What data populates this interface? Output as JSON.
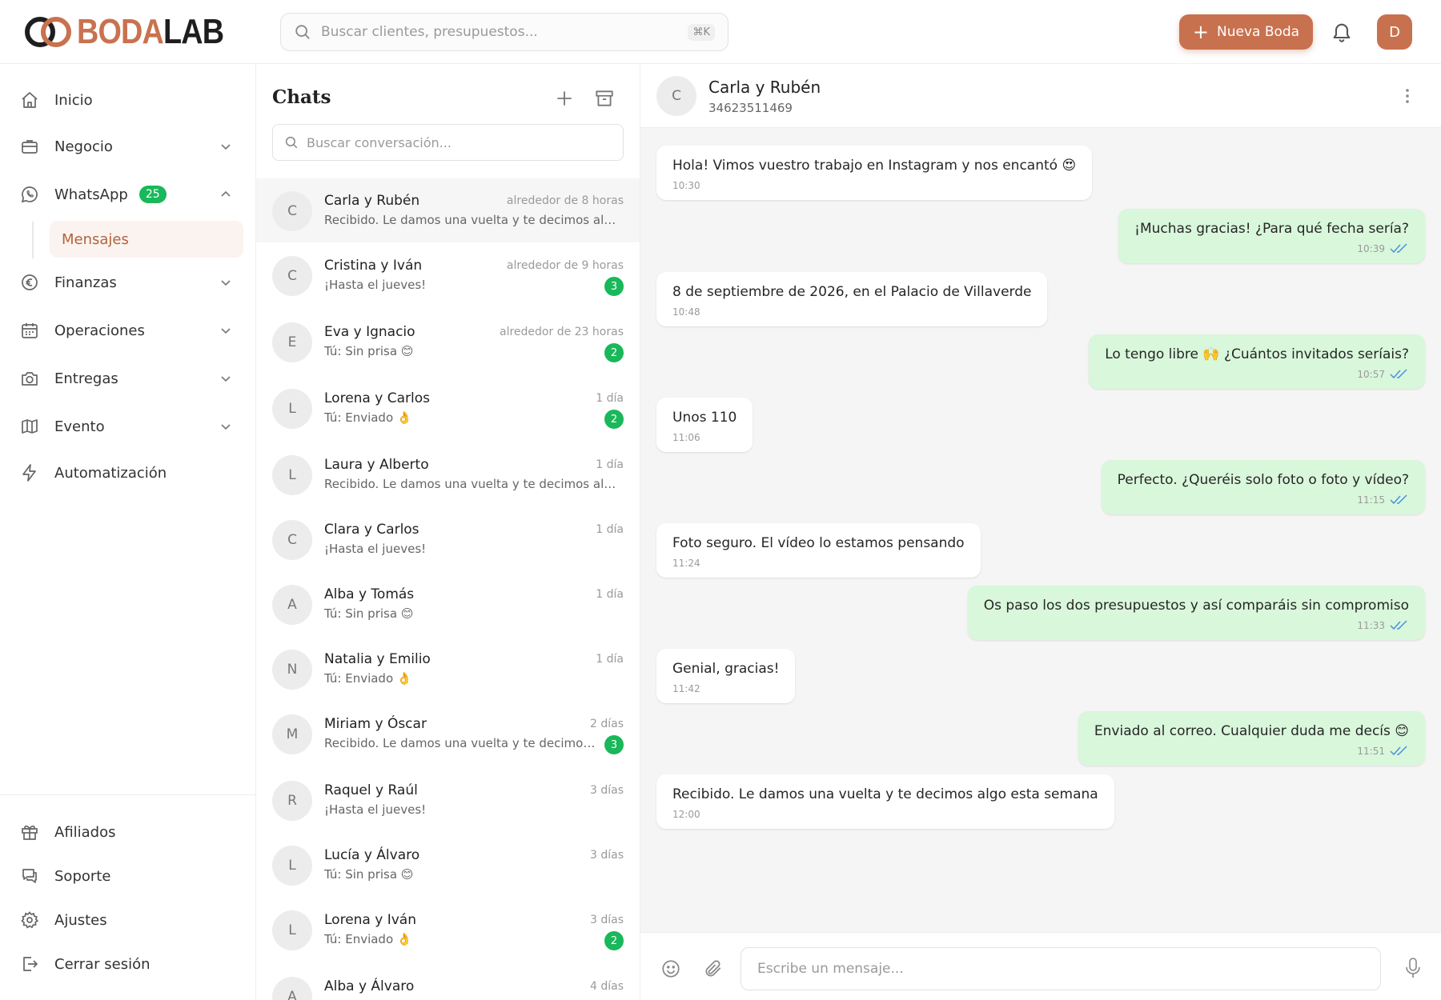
{
  "brand": {
    "logo_part1": "BODA",
    "logo_part2": "LAB",
    "accent": "#c8714f"
  },
  "top": {
    "search_placeholder": "Buscar clientes, presupuestos...",
    "shortcut": "⌘K",
    "new_button": "Nueva Boda",
    "avatar_initial": "D"
  },
  "sidebar": {
    "inicio": "Inicio",
    "negocio": "Negocio",
    "whatsapp": "WhatsApp",
    "whatsapp_badge": "25",
    "mensajes": "Mensajes",
    "finanzas": "Finanzas",
    "operaciones": "Operaciones",
    "entregas": "Entregas",
    "evento": "Evento",
    "automatizacion": "Automatización",
    "afiliados": "Afiliados",
    "soporte": "Soporte",
    "ajustes": "Ajustes",
    "cerrar_sesion": "Cerrar sesión"
  },
  "chatlist": {
    "title": "Chats",
    "search_placeholder": "Buscar conversación...",
    "items": [
      {
        "initial": "C",
        "name": "Carla y Rubén",
        "time": "alrededor de 8 horas",
        "preview": "Recibido. Le damos una vuelta y te decimos algo esta semana",
        "unread": ""
      },
      {
        "initial": "C",
        "name": "Cristina y Iván",
        "time": "alrededor de 9 horas",
        "preview": "¡Hasta el jueves!",
        "unread": "3"
      },
      {
        "initial": "E",
        "name": "Eva y Ignacio",
        "time": "alrededor de 23 horas",
        "preview": "Tú: Sin prisa 😊",
        "unread": "2"
      },
      {
        "initial": "L",
        "name": "Lorena y Carlos",
        "time": "1 día",
        "preview": "Tú: Enviado 👌",
        "unread": "2"
      },
      {
        "initial": "L",
        "name": "Laura y Alberto",
        "time": "1 día",
        "preview": "Recibido. Le damos una vuelta y te decimos algo esta semana",
        "unread": ""
      },
      {
        "initial": "C",
        "name": "Clara y Carlos",
        "time": "1 día",
        "preview": "¡Hasta el jueves!",
        "unread": ""
      },
      {
        "initial": "A",
        "name": "Alba y Tomás",
        "time": "1 día",
        "preview": "Tú: Sin prisa 😊",
        "unread": ""
      },
      {
        "initial": "N",
        "name": "Natalia y Emilio",
        "time": "1 día",
        "preview": "Tú: Enviado 👌",
        "unread": ""
      },
      {
        "initial": "M",
        "name": "Miriam y Óscar",
        "time": "2 días",
        "preview": "Recibido. Le damos una vuelta y te decimos algo esta semana",
        "unread": "3"
      },
      {
        "initial": "R",
        "name": "Raquel y Raúl",
        "time": "3 días",
        "preview": "¡Hasta el jueves!",
        "unread": ""
      },
      {
        "initial": "L",
        "name": "Lucía y Álvaro",
        "time": "3 días",
        "preview": "Tú: Sin prisa 😊",
        "unread": ""
      },
      {
        "initial": "L",
        "name": "Lorena y Iván",
        "time": "3 días",
        "preview": "Tú: Enviado 👌",
        "unread": "2"
      },
      {
        "initial": "A",
        "name": "Alba y Álvaro",
        "time": "4 días",
        "preview": "",
        "unread": ""
      }
    ]
  },
  "conversation": {
    "initial": "C",
    "name": "Carla y Rubén",
    "phone": "34623511469",
    "composer_placeholder": "Escribe un mensaje...",
    "messages": [
      {
        "dir": "in",
        "text": "Hola! Vimos vuestro trabajo en Instagram y nos encantó 😍",
        "time": "10:30"
      },
      {
        "dir": "out",
        "text": "¡Muchas gracias! ¿Para qué fecha sería?",
        "time": "10:39"
      },
      {
        "dir": "in",
        "text": "8 de septiembre de 2026, en el Palacio de Villaverde",
        "time": "10:48"
      },
      {
        "dir": "out",
        "text": "Lo tengo libre 🙌 ¿Cuántos invitados seríais?",
        "time": "10:57"
      },
      {
        "dir": "in",
        "text": "Unos 110",
        "time": "11:06"
      },
      {
        "dir": "out",
        "text": "Perfecto. ¿Queréis solo foto o foto y vídeo?",
        "time": "11:15"
      },
      {
        "dir": "in",
        "text": "Foto seguro. El vídeo lo estamos pensando",
        "time": "11:24"
      },
      {
        "dir": "out",
        "text": "Os paso los dos presupuestos y así comparáis sin compromiso",
        "time": "11:33"
      },
      {
        "dir": "in",
        "text": "Genial, gracias!",
        "time": "11:42"
      },
      {
        "dir": "out",
        "text": "Enviado al correo. Cualquier duda me decís 😊",
        "time": "11:51"
      },
      {
        "dir": "in",
        "text": "Recibido. Le damos una vuelta y te decimos algo esta semana",
        "time": "12:00"
      }
    ]
  }
}
